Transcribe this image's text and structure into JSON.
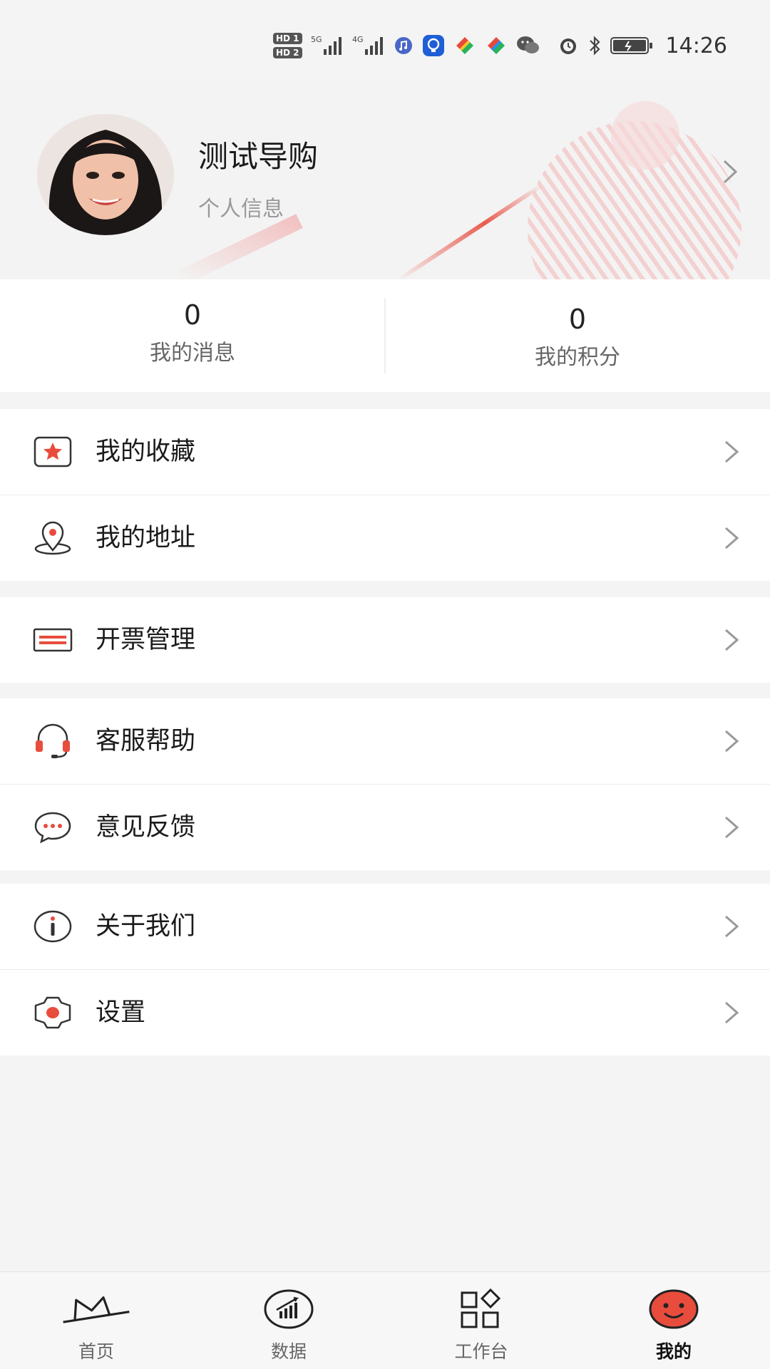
{
  "status_bar": {
    "time": "14:26",
    "sim1": "HD 1",
    "sim2": "HD 2",
    "net1": "5G",
    "net2": "4G",
    "icons": [
      "hd-sim-icon",
      "signal-5g-icon",
      "signal-4g-icon",
      "music-icon",
      "notification-app-icon",
      "browser-icon",
      "browser-icon-2",
      "wechat-icon",
      "alarm-icon",
      "bluetooth-icon",
      "battery-icon"
    ]
  },
  "profile": {
    "name": "测试导购",
    "subtitle": "个人信息",
    "accent_color": "#e84c3d"
  },
  "stats": {
    "messages": {
      "value": "0",
      "label": "我的消息"
    },
    "points": {
      "value": "0",
      "label": "我的积分"
    }
  },
  "menu": {
    "groups": [
      {
        "items": [
          {
            "label": "我的收藏",
            "icon": "favorites-star-icon"
          },
          {
            "label": "我的地址",
            "icon": "location-pin-icon"
          }
        ]
      },
      {
        "items": [
          {
            "label": "开票管理",
            "icon": "invoice-icon"
          }
        ]
      },
      {
        "items": [
          {
            "label": "客服帮助",
            "icon": "headset-icon"
          },
          {
            "label": "意见反馈",
            "icon": "feedback-chat-icon"
          }
        ]
      },
      {
        "items": [
          {
            "label": "关于我们",
            "icon": "info-icon"
          },
          {
            "label": "设置",
            "icon": "gear-icon"
          }
        ]
      }
    ]
  },
  "tab_bar": {
    "tabs": [
      {
        "label": "首页",
        "icon": "home-icon",
        "active": false
      },
      {
        "label": "数据",
        "icon": "data-chart-icon",
        "active": false
      },
      {
        "label": "工作台",
        "icon": "workbench-grid-icon",
        "active": false
      },
      {
        "label": "我的",
        "icon": "smiley-profile-icon",
        "active": true
      }
    ]
  }
}
